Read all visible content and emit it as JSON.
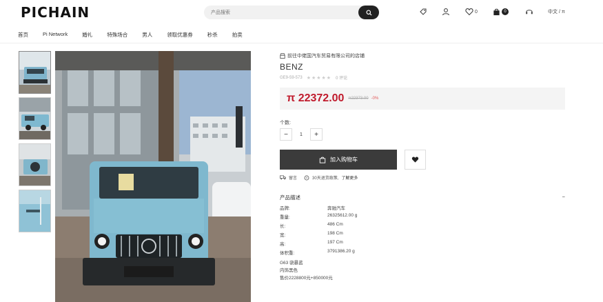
{
  "header": {
    "logo": "PICHAIN",
    "search_placeholder": "产品搜索",
    "wishlist_count": "0",
    "cart_count": "0",
    "language": "中文 / π"
  },
  "nav": {
    "items": [
      "首页",
      "Pi Network",
      "婚礼",
      "特殊场合",
      "男人",
      "领取优惠券",
      "秒杀",
      "拍卖"
    ]
  },
  "gallery": {
    "thumbnails": [
      "thumb-1",
      "thumb-2",
      "thumb-3",
      "thumb-4"
    ]
  },
  "product": {
    "shop": "前往中佬国汽车贸易有限公司的店铺",
    "title": "BENZ",
    "sku": "GE9-59-573",
    "reviews": "0 评论",
    "price": "π 22372.00",
    "old_price": "π22373.00",
    "discount": "-0%",
    "qty_label": "个数:",
    "qty_value": "1",
    "cart_label": "加入购物车",
    "service_1": "留言",
    "service_2": "30天退货政策,",
    "service_link": "了解更多"
  },
  "description": {
    "heading": "产品描述",
    "specs": [
      {
        "k": "品牌:",
        "v": "奔驰汽车"
      },
      {
        "k": "重量:",
        "v": "26325612.00 g"
      },
      {
        "k": "长:",
        "v": "486 Cm"
      },
      {
        "k": "宽:",
        "v": "198 Cm"
      },
      {
        "k": "高:",
        "v": "197 Cm"
      },
      {
        "k": "体积重:",
        "v": "3791386.20 g"
      }
    ],
    "extra": [
      "G63 骁暴蓝",
      "内饰黑色",
      "售价2228800元+850000元"
    ]
  },
  "colors": {
    "price": "#c01a2c",
    "cart_button": "#3b3b3b"
  }
}
